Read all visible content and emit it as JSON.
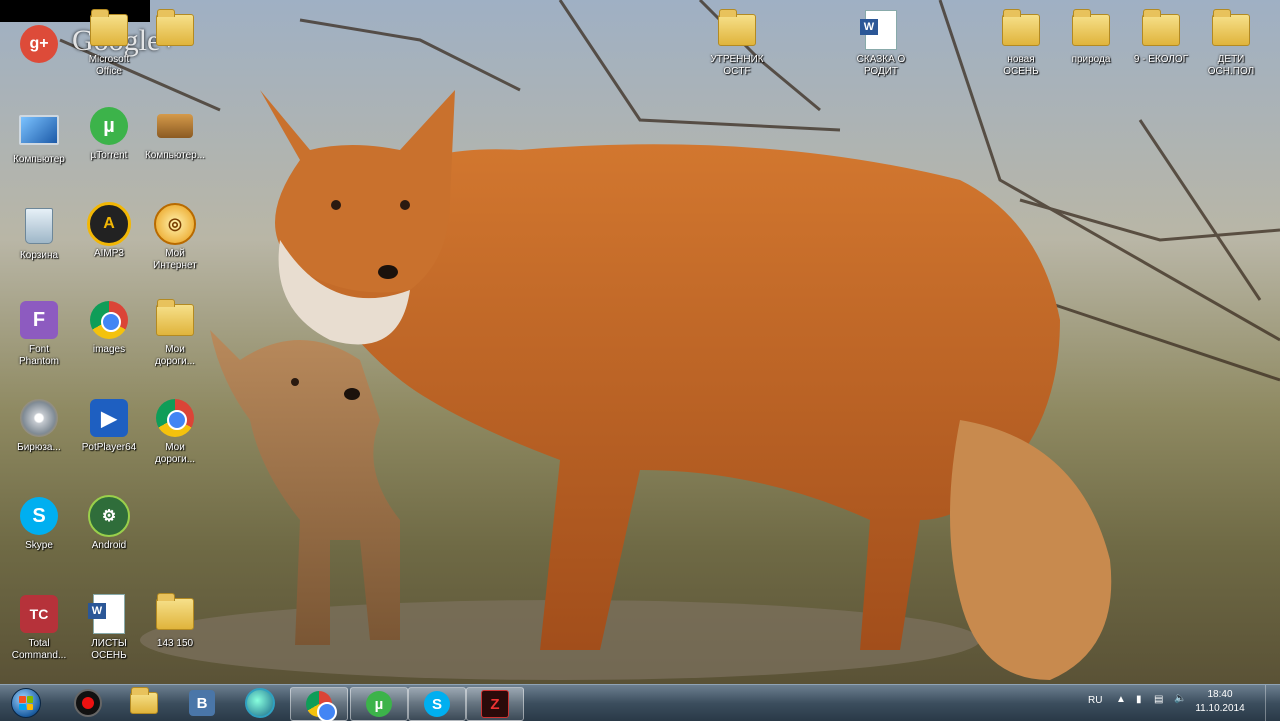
{
  "desktop": {
    "google_plus_text": "Google+",
    "icons": [
      {
        "id": "google-plus",
        "label": "",
        "icon": "google-plus-icon"
      },
      {
        "id": "office",
        "label": "Microsoft\nOffice",
        "icon": "folder-icon"
      },
      {
        "id": "folder-top3",
        "label": "",
        "icon": "folder-icon"
      },
      {
        "id": "computer",
        "label": "Компьютер",
        "icon": "computer-icon"
      },
      {
        "id": "utorrent",
        "label": "µTorrent",
        "icon": "utorrent-icon"
      },
      {
        "id": "network",
        "label": "Компьютер...",
        "icon": "network-icon"
      },
      {
        "id": "recycle",
        "label": "Корзина",
        "icon": "recycle-bin-icon"
      },
      {
        "id": "aimp",
        "label": "AIMP3",
        "icon": "aimp-icon"
      },
      {
        "id": "internet",
        "label": "Мой\nИнтернет",
        "icon": "internet-icon"
      },
      {
        "id": "fontphantom",
        "label": "Font\nPhantom",
        "icon": "font-phantom-icon"
      },
      {
        "id": "chrome1",
        "label": "images",
        "icon": "chrome-icon"
      },
      {
        "id": "folder-roads",
        "label": "Мои\nдороги...",
        "icon": "folder-icon"
      },
      {
        "id": "burnaware",
        "label": "Бирюза...",
        "icon": "disc-icon"
      },
      {
        "id": "potplayer",
        "label": "PotPlayer64",
        "icon": "potplayer-icon"
      },
      {
        "id": "chrome2",
        "label": "Мои\nдороги...",
        "icon": "chrome-icon"
      },
      {
        "id": "skype",
        "label": "Skype",
        "icon": "skype-icon"
      },
      {
        "id": "android",
        "label": "Android",
        "icon": "android-icon"
      },
      {
        "id": "totalcmd",
        "label": "Total\nCommand...",
        "icon": "total-commander-icon"
      },
      {
        "id": "listy",
        "label": "ЛИСТЫ\nОСЕНЬ",
        "icon": "word-doc-icon"
      },
      {
        "id": "folder-bottom",
        "label": "143 150",
        "icon": "folder-icon"
      },
      {
        "id": "folder-morning",
        "label": "УТРЕННИК\nOCTF",
        "icon": "folder-icon"
      },
      {
        "id": "doc-skazka",
        "label": "СКАЗКА О\nРОДИТ",
        "icon": "word-doc-icon"
      },
      {
        "id": "folder-autumn",
        "label": "новая\nОСЕНЬ",
        "icon": "folder-icon"
      },
      {
        "id": "folder-nature",
        "label": "природа",
        "icon": "folder-icon"
      },
      {
        "id": "folder-ecology",
        "label": "9 - ЕКОЛОГ",
        "icon": "folder-icon"
      },
      {
        "id": "folder-kids",
        "label": "ДЕТИ\nОСН.ПОЛ",
        "icon": "folder-icon"
      }
    ]
  },
  "taskbar": {
    "apps": [
      {
        "id": "record",
        "icon": "record-icon"
      },
      {
        "id": "explorer",
        "icon": "folder-icon"
      },
      {
        "id": "vk",
        "icon": "vk-icon",
        "text": "B"
      },
      {
        "id": "earth",
        "icon": "globe-icon"
      },
      {
        "id": "chrome",
        "icon": "chrome-icon"
      },
      {
        "id": "utorrent",
        "icon": "utorrent-icon"
      },
      {
        "id": "skype",
        "icon": "skype-icon",
        "text": "S"
      },
      {
        "id": "zone",
        "icon": "game-icon",
        "text": "Z"
      }
    ],
    "tray": {
      "language": "RU",
      "time": "18:40",
      "date": "11.10.2014"
    }
  }
}
